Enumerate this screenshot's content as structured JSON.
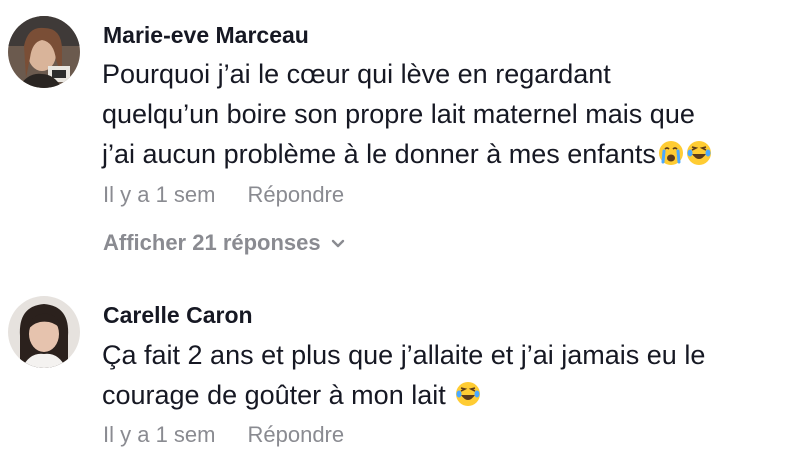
{
  "comments": [
    {
      "author": "Marie-eve Marceau",
      "lines": [
        "Pourquoi j’ai le cœur qui lève en regardant",
        "quelqu’un boire son propre lait maternel mais que",
        "j’ai aucun problème à le donner à mes enfants"
      ],
      "emojis": [
        "crying-face-emoji",
        "laughing-tears-emoji"
      ],
      "time": "Il y a 1 sem",
      "reply_label": "Répondre",
      "view_replies_label": "Afficher 21 réponses"
    },
    {
      "author": "Carelle Caron",
      "lines": [
        "Ça fait 2 ans et plus que j’allaite et j’ai jamais eu le",
        "courage de goûter à mon lait"
      ],
      "emojis": [
        "laughing-tears-emoji"
      ],
      "time": "Il y a 1 sem",
      "reply_label": "Répondre"
    }
  ],
  "colors": {
    "text": "#161823",
    "muted": "#8a8b91",
    "background": "#ffffff"
  }
}
